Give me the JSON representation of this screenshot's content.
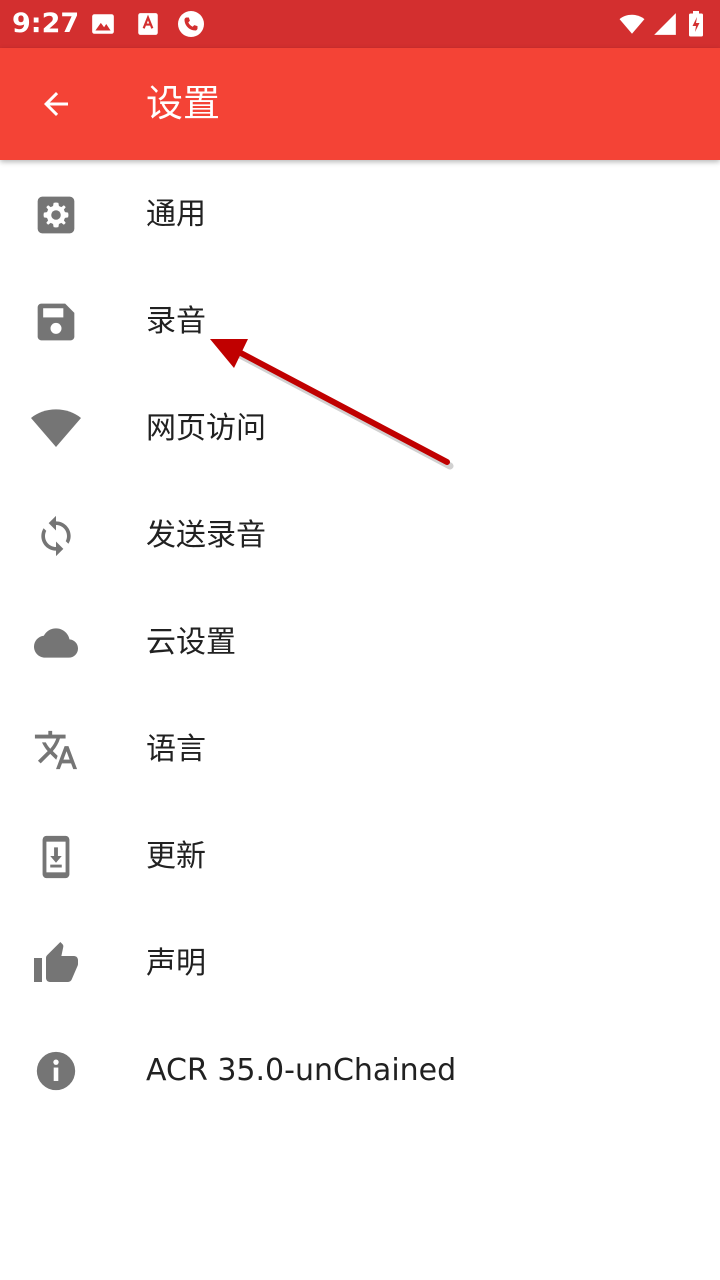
{
  "status_bar": {
    "time": "9:27",
    "left_icons": [
      "image-icon",
      "acrobat-icon",
      "phone-call-icon"
    ],
    "right_icons": [
      "wifi-icon",
      "signal-icon",
      "battery-charging-icon"
    ]
  },
  "app_bar": {
    "title": "设置",
    "background_color": "#f44336",
    "status_color": "#d32f2f"
  },
  "settings": {
    "items": [
      {
        "label": "通用",
        "icon": "gear-icon"
      },
      {
        "label": "录音",
        "icon": "save-icon"
      },
      {
        "label": "网页访问",
        "icon": "wifi-icon"
      },
      {
        "label": "发送录音",
        "icon": "sync-icon"
      },
      {
        "label": "云设置",
        "icon": "cloud-icon"
      },
      {
        "label": "语言",
        "icon": "translate-icon"
      },
      {
        "label": "更新",
        "icon": "phone-download-icon"
      },
      {
        "label": "声明",
        "icon": "thumbs-up-icon"
      },
      {
        "label": "ACR 35.0-unChained",
        "icon": "info-icon"
      }
    ]
  },
  "annotation_color": "#c00000"
}
